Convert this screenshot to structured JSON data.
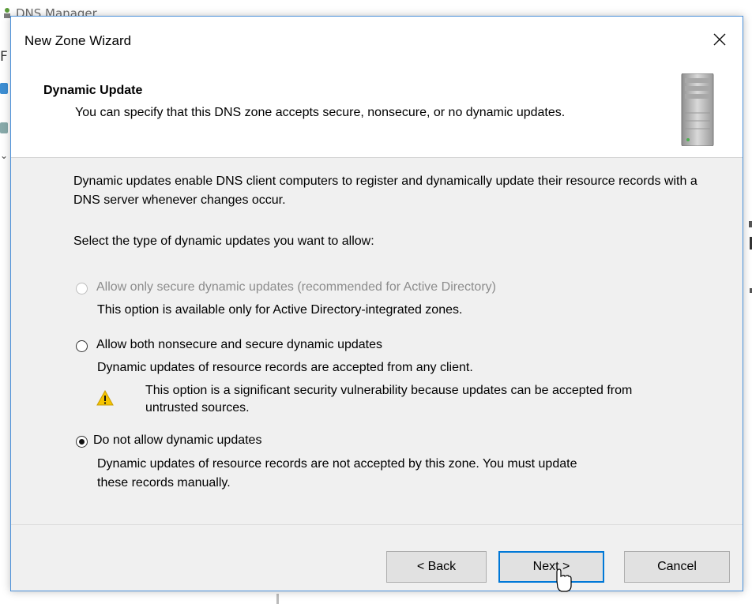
{
  "background_window": {
    "title": "DNS Manager",
    "edge_letter": "F"
  },
  "dialog": {
    "title": "New Zone Wizard",
    "close_glyph": "✕"
  },
  "header": {
    "title": "Dynamic Update",
    "description": "You can specify that this DNS zone accepts secure, nonsecure, or no dynamic updates.",
    "icon": "server-tower-icon"
  },
  "content": {
    "intro": "Dynamic updates enable DNS client computers to register and dynamically update their resource records with a DNS server whenever changes occur.",
    "prompt": "Select the type of dynamic updates you want to allow:",
    "options": [
      {
        "label": "Allow only secure dynamic updates (recommended for Active Directory)",
        "description": "This option is available only for Active Directory-integrated zones.",
        "enabled": false,
        "selected": false
      },
      {
        "label": "Allow both nonsecure and secure dynamic updates",
        "description": "Dynamic updates of resource records are accepted from any client.",
        "warning": "This option is a significant security vulnerability because updates can be accepted from untrusted sources.",
        "warning_icon": "warning-triangle-icon",
        "enabled": true,
        "selected": false
      },
      {
        "label": "Do not allow dynamic updates",
        "description_line1": "Dynamic updates of resource records are not accepted by this zone. You must update",
        "description_line2": "these records manually.",
        "enabled": true,
        "selected": true
      }
    ]
  },
  "buttons": {
    "back": "< Back",
    "next": "Next >",
    "cancel": "Cancel"
  },
  "colors": {
    "dialog_border": "#4a90d9",
    "default_button_border": "#0078d7",
    "warning_yellow": "#f5c400"
  }
}
